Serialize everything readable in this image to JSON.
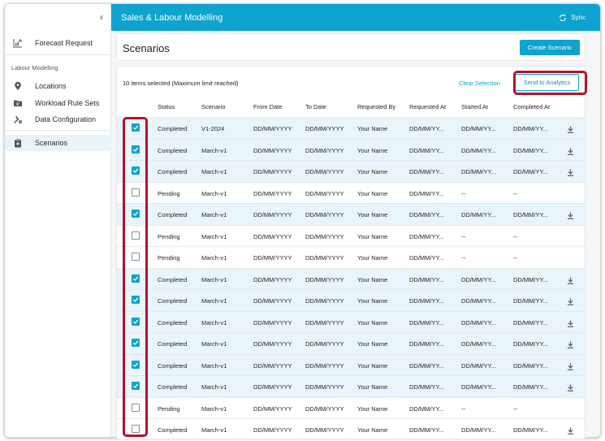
{
  "header": {
    "title": "Sales & Labour Modelling",
    "sync_label": "Sync"
  },
  "sidebar": {
    "collapse_icon": "chevron-left-icon",
    "top_item": {
      "label": "Forecast Request",
      "icon": "chart-plus-icon"
    },
    "group_label": "Labour Modelling",
    "items": [
      {
        "label": "Locations",
        "icon": "location-pin-icon"
      },
      {
        "label": "Workload Rule Sets",
        "icon": "folder-icon"
      },
      {
        "label": "Data Configuration",
        "icon": "wrench-gear-icon"
      }
    ],
    "bottom_item": {
      "label": "Scenarios",
      "icon": "clipboard-icon",
      "active": true
    }
  },
  "page": {
    "title": "Scenarios",
    "create_label": "Create Scenario"
  },
  "toolbar": {
    "selection_info": "10 items selected (Maximum limit reached)",
    "clear_label": "Clear Selection",
    "send_label": "Send to Analytics"
  },
  "table": {
    "columns": [
      "Status",
      "Scenario",
      "From Date",
      "To Date",
      "Requested By",
      "Requested At",
      "Started At",
      "Completed At"
    ],
    "rows": [
      {
        "selected": true,
        "status": "Completed",
        "scenario": "V1-2024",
        "from": "DD/MM/YYYY",
        "to": "DD/MM/YYYY",
        "by": "Your Name",
        "req_at": "DD/MM/YY...",
        "started": "DD/MM/YY...",
        "completed": "DD/MM/YY...",
        "download": true
      },
      {
        "selected": true,
        "status": "Completed",
        "scenario": "March-v1",
        "from": "DD/MM/YYYY",
        "to": "DD/MM/YYYY",
        "by": "Your Name",
        "req_at": "DD/MM/YY...",
        "started": "DD/MM/YY...",
        "completed": "DD/MM/YY...",
        "download": true
      },
      {
        "selected": true,
        "status": "Completed",
        "scenario": "March-v1",
        "from": "DD/MM/YYYY",
        "to": "DD/MM/YYYY",
        "by": "Your Name",
        "req_at": "DD/MM/YY...",
        "started": "DD/MM/YY...",
        "completed": "DD/MM/YY...",
        "download": true
      },
      {
        "selected": false,
        "status": "Pending",
        "scenario": "March-v1",
        "from": "DD/MM/YYYY",
        "to": "DD/MM/YYYY",
        "by": "Your Name",
        "req_at": "DD/MM/YY...",
        "started": "--",
        "completed": "--",
        "download": false
      },
      {
        "selected": true,
        "status": "Completed",
        "scenario": "March-v1",
        "from": "DD/MM/YYYY",
        "to": "DD/MM/YYYY",
        "by": "Your Name",
        "req_at": "DD/MM/YY...",
        "started": "DD/MM/YY...",
        "completed": "DD/MM/YY...",
        "download": true
      },
      {
        "selected": false,
        "status": "Pending",
        "scenario": "March-v1",
        "from": "DD/MM/YYYY",
        "to": "DD/MM/YYYY",
        "by": "Your Name",
        "req_at": "DD/MM/YY...",
        "started": "--",
        "completed": "--",
        "download": false
      },
      {
        "selected": false,
        "status": "Pending",
        "scenario": "March-v1",
        "from": "DD/MM/YYYY",
        "to": "DD/MM/YYYY",
        "by": "Your Name",
        "req_at": "DD/MM/YY...",
        "started": "--",
        "completed": "--",
        "download": false
      },
      {
        "selected": true,
        "status": "Completed",
        "scenario": "March-v1",
        "from": "DD/MM/YYYY",
        "to": "DD/MM/YYYY",
        "by": "Your Name",
        "req_at": "DD/MM/YY...",
        "started": "DD/MM/YY...",
        "completed": "DD/MM/YY...",
        "download": true
      },
      {
        "selected": true,
        "status": "Completed",
        "scenario": "March-v1",
        "from": "DD/MM/YYYY",
        "to": "DD/MM/YYYY",
        "by": "Your Name",
        "req_at": "DD/MM/YY...",
        "started": "DD/MM/YY...",
        "completed": "DD/MM/YY...",
        "download": true
      },
      {
        "selected": true,
        "status": "Completed",
        "scenario": "March-v1",
        "from": "DD/MM/YYYY",
        "to": "DD/MM/YYYY",
        "by": "Your Name",
        "req_at": "DD/MM/YY...",
        "started": "DD/MM/YY...",
        "completed": "DD/MM/YY...",
        "download": true
      },
      {
        "selected": true,
        "status": "Completed",
        "scenario": "March-v1",
        "from": "DD/MM/YYYY",
        "to": "DD/MM/YYYY",
        "by": "Your Name",
        "req_at": "DD/MM/YY...",
        "started": "DD/MM/YY...",
        "completed": "DD/MM/YY...",
        "download": true
      },
      {
        "selected": true,
        "status": "Completed",
        "scenario": "March-v1",
        "from": "DD/MM/YYYY",
        "to": "DD/MM/YYYY",
        "by": "Your Name",
        "req_at": "DD/MM/YY...",
        "started": "DD/MM/YY...",
        "completed": "DD/MM/YY...",
        "download": true
      },
      {
        "selected": true,
        "status": "Completed",
        "scenario": "March-v1",
        "from": "DD/MM/YYYY",
        "to": "DD/MM/YYYY",
        "by": "Your Name",
        "req_at": "DD/MM/YY...",
        "started": "DD/MM/YY...",
        "completed": "DD/MM/YY...",
        "download": true
      },
      {
        "selected": false,
        "status": "Pending",
        "scenario": "March-v1",
        "from": "DD/MM/YYYY",
        "to": "DD/MM/YYYY",
        "by": "Your Name",
        "req_at": "DD/MM/YY...",
        "started": "--",
        "completed": "--",
        "download": false
      },
      {
        "selected": false,
        "status": "Completed",
        "scenario": "March-v1",
        "from": "DD/MM/YYYY",
        "to": "DD/MM/YYYY",
        "by": "Your Name",
        "req_at": "DD/MM/YY...",
        "started": "DD/MM/YY...",
        "completed": "DD/MM/YY...",
        "download": true
      }
    ]
  },
  "colors": {
    "accent": "#0fa3cf",
    "selected_row": "#e9f5fa",
    "highlight": "#b3122c"
  }
}
